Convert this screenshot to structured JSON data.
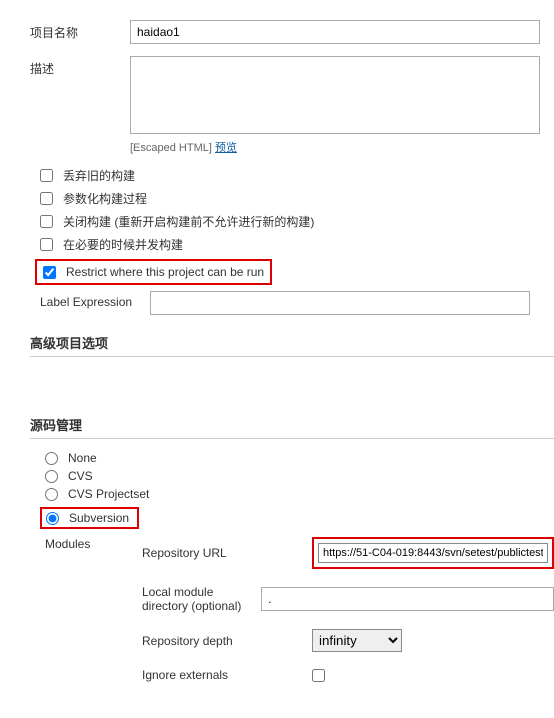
{
  "project": {
    "name_label": "项目名称",
    "name_value": "haidao1",
    "desc_label": "描述",
    "desc_value": "",
    "escaped_html": "[Escaped HTML]",
    "preview_link": "预览"
  },
  "options": {
    "discard_label": "丢弃旧的构建",
    "param_build_label": "参数化构建过程",
    "close_build_label": "关闭构建 (重新开启构建前不允许进行新的构建)",
    "concurrent_label": "在必要的时候并发构建",
    "restrict_label": "Restrict where this project can be run",
    "restrict_checked": true,
    "label_expr_label": "Label Expression",
    "label_expr_value": ""
  },
  "advanced_section": "高级项目选项",
  "scm": {
    "section": "源码管理",
    "none": "None",
    "cvs": "CVS",
    "cvs_projectset": "CVS Projectset",
    "subversion": "Subversion",
    "selected": "subversion",
    "modules_label": "Modules",
    "repo_url_label": "Repository URL",
    "repo_url_value": "https://51-C04-019:8443/svn/setest/publictest",
    "local_dir_label": "Local module directory (optional)",
    "local_dir_value": ".",
    "repo_depth_label": "Repository depth",
    "repo_depth_value": "infinity",
    "ignore_ext_label": "Ignore externals",
    "ignore_ext_checked": false
  }
}
